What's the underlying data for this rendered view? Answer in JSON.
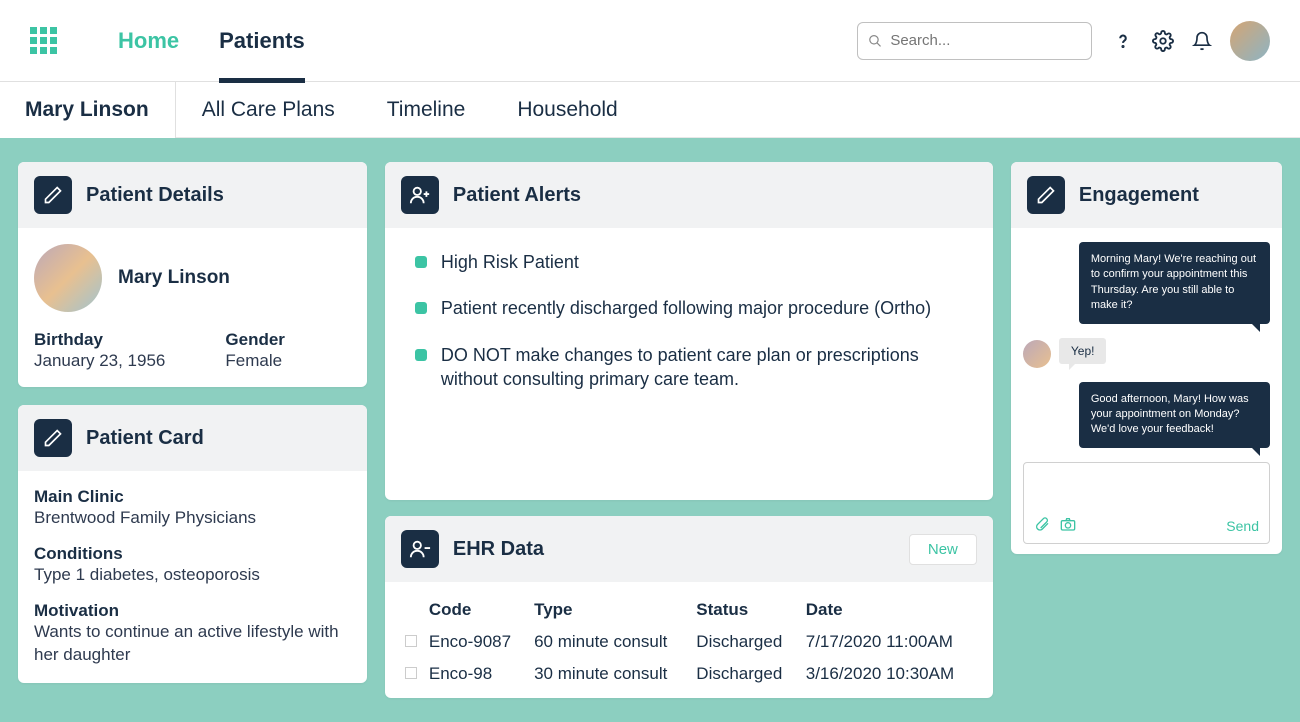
{
  "nav": {
    "home": "Home",
    "patients": "Patients"
  },
  "search": {
    "placeholder": "Search..."
  },
  "subnav": {
    "patient_name": "Mary Linson",
    "care_plans": "All Care Plans",
    "timeline": "Timeline",
    "household": "Household"
  },
  "patient_details": {
    "title": "Patient Details",
    "name": "Mary Linson",
    "birthday_label": "Birthday",
    "birthday": "January 23, 1956",
    "gender_label": "Gender",
    "gender": "Female"
  },
  "patient_card": {
    "title": "Patient Card",
    "clinic_label": "Main Clinic",
    "clinic": "Brentwood Family Physicians",
    "conditions_label": "Conditions",
    "conditions": "Type 1 diabetes, osteoporosis",
    "motivation_label": "Motivation",
    "motivation": "Wants to continue an active lifestyle with her daughter"
  },
  "alerts": {
    "title": "Patient Alerts",
    "items": [
      "High Risk Patient",
      "Patient recently discharged following major procedure (Ortho)",
      "DO NOT make changes to patient care plan or prescriptions without consulting primary care team."
    ]
  },
  "ehr": {
    "title": "EHR Data",
    "new_label": "New",
    "headers": {
      "code": "Code",
      "type": "Type",
      "status": "Status",
      "date": "Date"
    },
    "rows": [
      {
        "code": "Enco-9087",
        "type": "60 minute consult",
        "status": "Discharged",
        "date": "7/17/2020 11:00AM"
      },
      {
        "code": "Enco-98",
        "type": "30 minute consult",
        "status": "Discharged",
        "date": "3/16/2020 10:30AM"
      }
    ]
  },
  "engagement": {
    "title": "Engagement",
    "msg1": "Morning Mary! We're reaching out to confirm your appointment this Thursday. Are you still able to make it?",
    "reply": "Yep!",
    "msg2": "Good afternoon, Mary! How was your appointment on Monday? We'd love your feedback!",
    "send_label": "Send"
  }
}
